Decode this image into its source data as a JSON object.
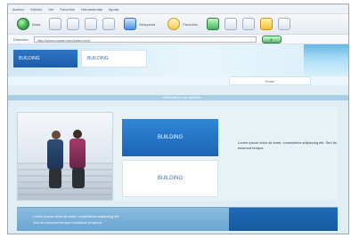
{
  "browser": {
    "menubar": {
      "items": [
        "Archivo",
        "Edición",
        "Ver",
        "Favoritos",
        "Herramientas",
        "Ayuda"
      ]
    },
    "toolbar": {
      "back_label": "Atrás",
      "search_label": "Búsqueda",
      "favorites_label": "Favoritos"
    },
    "address": {
      "label": "Dirección",
      "url": "http://www.mysite.com/index.html",
      "go_label": "Ir"
    }
  },
  "site": {
    "header": {
      "logo_blue_text": "BUILDING",
      "logo_white_text": "BUILDING",
      "nav_active_label": "Home"
    },
    "band": {
      "text": "Welcome to our website"
    },
    "content": {
      "logo_card_blue_text": "BUILDING",
      "logo_card_white_text": "BUILDING",
      "body_text": "Lorem ipsum dolor sit amet, consectetur adipiscing elit. Sed do eiusmod tempor."
    },
    "footer": {
      "line1": "Lorem ipsum dolor sit amet, consectetur adipiscing elit.",
      "line2": "Sed do eiusmod tempor incididunt ut labore."
    }
  }
}
